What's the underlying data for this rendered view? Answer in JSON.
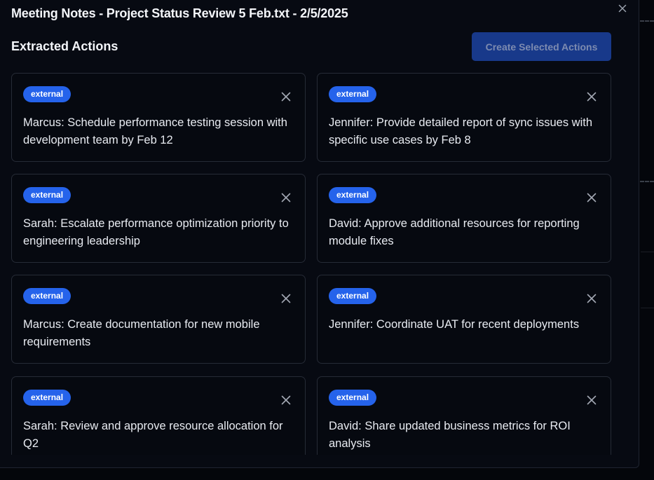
{
  "modal": {
    "title": "Meeting Notes - Project Status Review 5 Feb.txt - 2/5/2025",
    "section_title": "Extracted Actions",
    "create_button_label": "Create Selected Actions"
  },
  "colors": {
    "badge": "#2563eb",
    "primary_button_disabled": "#18398a",
    "background": "#070a12"
  },
  "actions": [
    {
      "tag": "external",
      "text": "Marcus: Schedule performance testing session with development team by Feb 12"
    },
    {
      "tag": "external",
      "text": "Jennifer: Provide detailed report of sync issues with specific use cases by Feb 8"
    },
    {
      "tag": "external",
      "text": "Sarah: Escalate performance optimization priority to engineering leadership"
    },
    {
      "tag": "external",
      "text": "David: Approve additional resources for reporting module fixes"
    },
    {
      "tag": "external",
      "text": "Marcus: Create documentation for new mobile requirements"
    },
    {
      "tag": "external",
      "text": "Jennifer: Coordinate UAT for recent deployments"
    },
    {
      "tag": "external",
      "text": "Sarah: Review and approve resource allocation for Q2"
    },
    {
      "tag": "external",
      "text": "David: Share updated business metrics for ROI analysis"
    }
  ],
  "icons": {
    "close": "close-icon"
  }
}
